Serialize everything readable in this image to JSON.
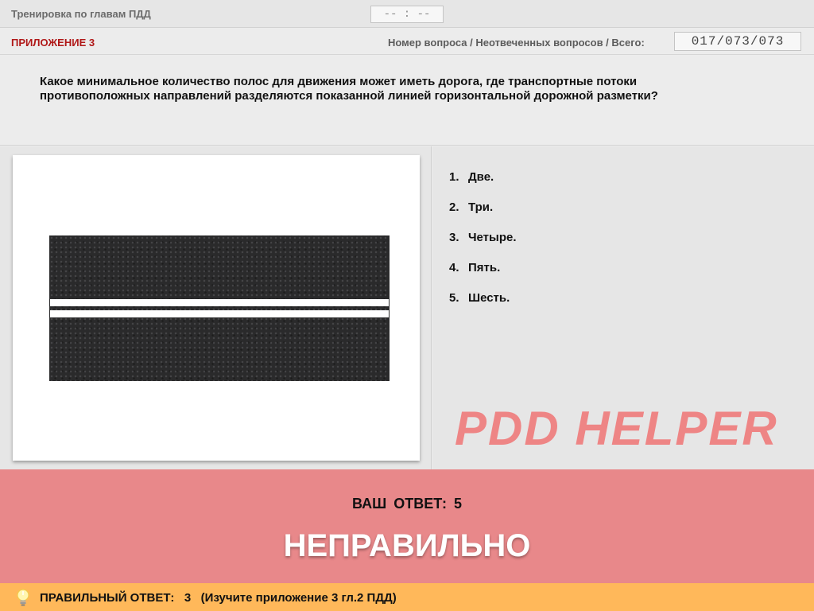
{
  "header": {
    "app_title": "Тренировка по главам ПДД",
    "timer": "-- : --"
  },
  "subheader": {
    "appendix": "ПРИЛОЖЕНИЕ 3",
    "counter_label": "Номер вопроса / Неотвеченных вопросов / Всего:",
    "counter_value": "017/073/073"
  },
  "question": {
    "text": "Какое минимальное количество полос для движения может иметь дорога, где транспортные потоки противоположных направлений разделяются показанной линией горизонтальной дорожной разметки?"
  },
  "answers": [
    {
      "num": "1.",
      "text": "Две."
    },
    {
      "num": "2.",
      "text": "Три."
    },
    {
      "num": "3.",
      "text": "Четыре."
    },
    {
      "num": "4.",
      "text": "Пять."
    },
    {
      "num": "5.",
      "text": "Шесть."
    }
  ],
  "watermark": "PDD HELPER",
  "result": {
    "your_answer": "ВАШ ОТВЕТ:  5",
    "verdict": "НЕПРАВИЛЬНО",
    "color": "#e8888a"
  },
  "hint": {
    "text": "ПРАВИЛЬНЫЙ ОТВЕТ:   3   (Изучите приложение 3 гл.2 ПДД)",
    "icon": "lightbulb-icon",
    "color": "#ffb85a"
  }
}
